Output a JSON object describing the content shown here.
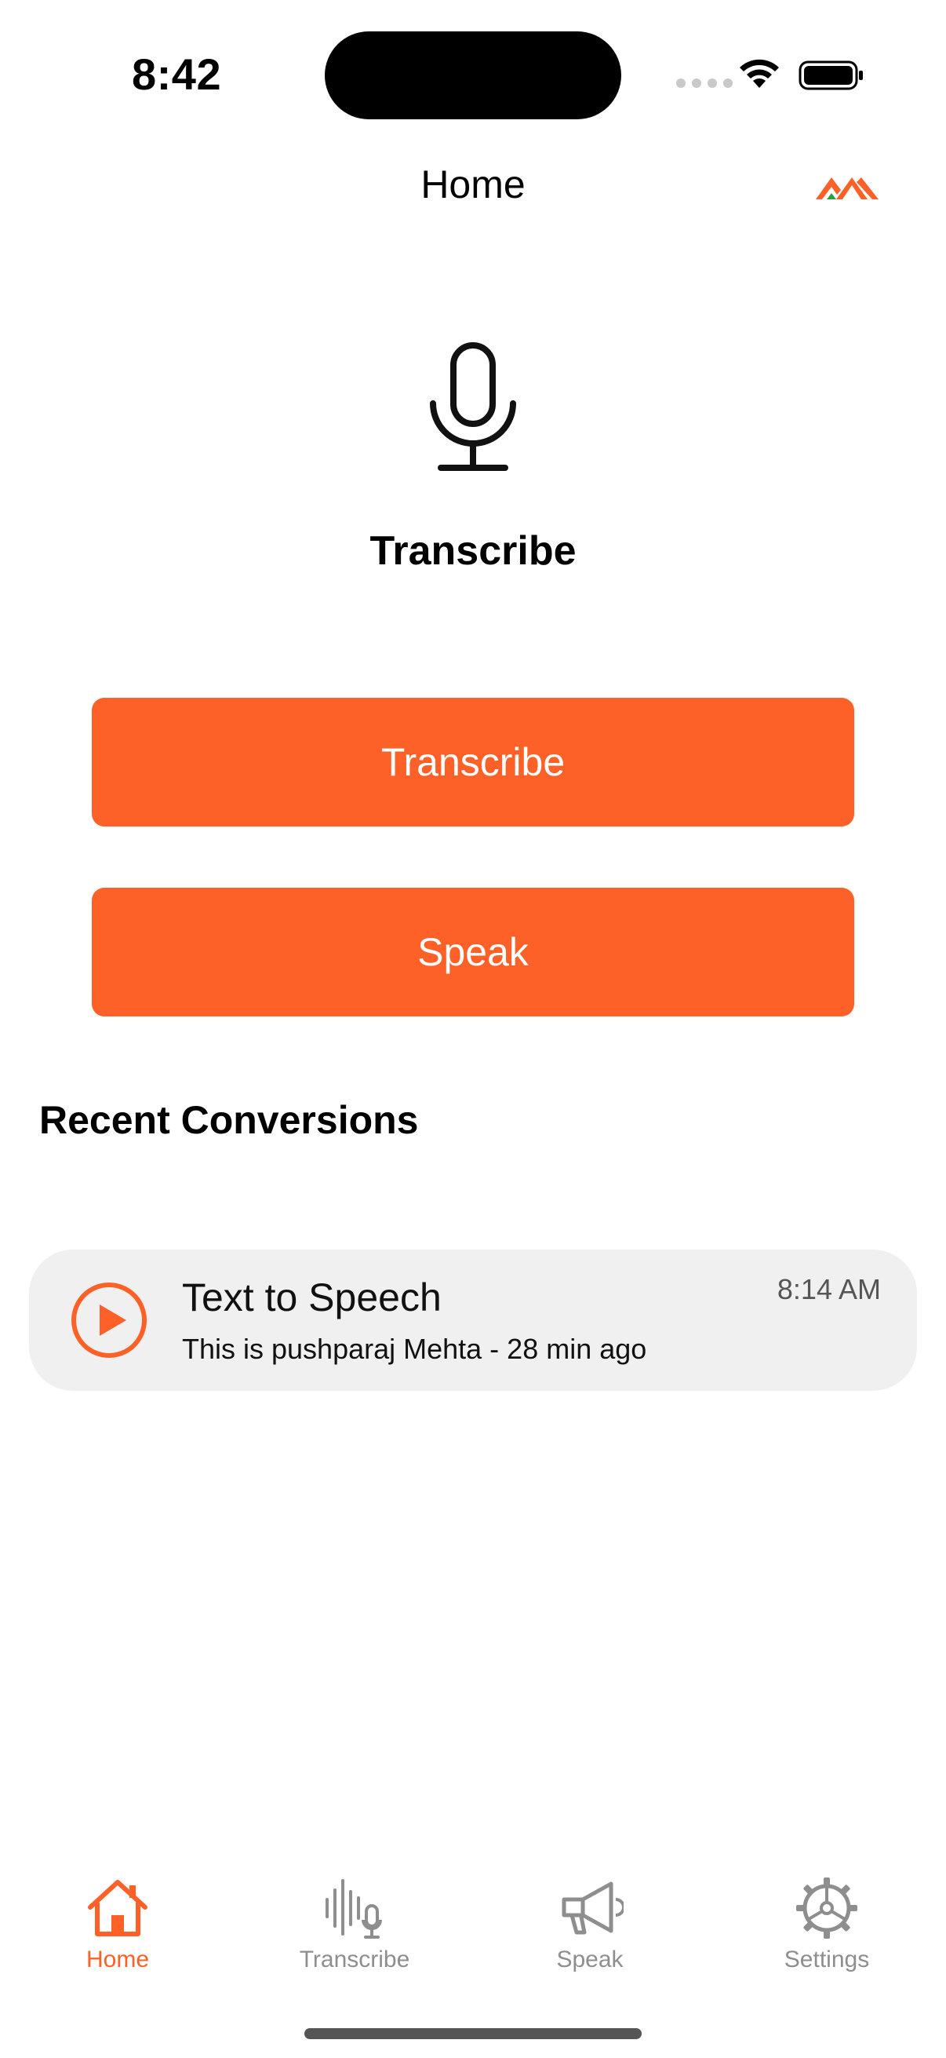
{
  "status_bar": {
    "time": "8:42"
  },
  "nav": {
    "title": "Home",
    "logo_icon": "brand-logo-icon"
  },
  "hero": {
    "icon": "microphone-icon",
    "title": "Transcribe"
  },
  "actions": {
    "transcribe_label": "Transcribe",
    "speak_label": "Speak"
  },
  "recent": {
    "title": "Recent Conversions",
    "items": [
      {
        "title": "Text to Speech",
        "subtitle": "This is pushparaj Mehta - 28 min ago",
        "time": "8:14 AM",
        "icon": "play-icon"
      }
    ]
  },
  "tab_bar": {
    "items": [
      {
        "label": "Home",
        "icon": "home-icon",
        "active": true
      },
      {
        "label": "Transcribe",
        "icon": "waveform-mic-icon",
        "active": false
      },
      {
        "label": "Speak",
        "icon": "megaphone-icon",
        "active": false
      },
      {
        "label": "Settings",
        "icon": "gear-icon",
        "active": false
      }
    ]
  },
  "colors": {
    "accent": "#fe6128",
    "card_bg": "#f0f0f0",
    "inactive": "#8e8e8e"
  }
}
